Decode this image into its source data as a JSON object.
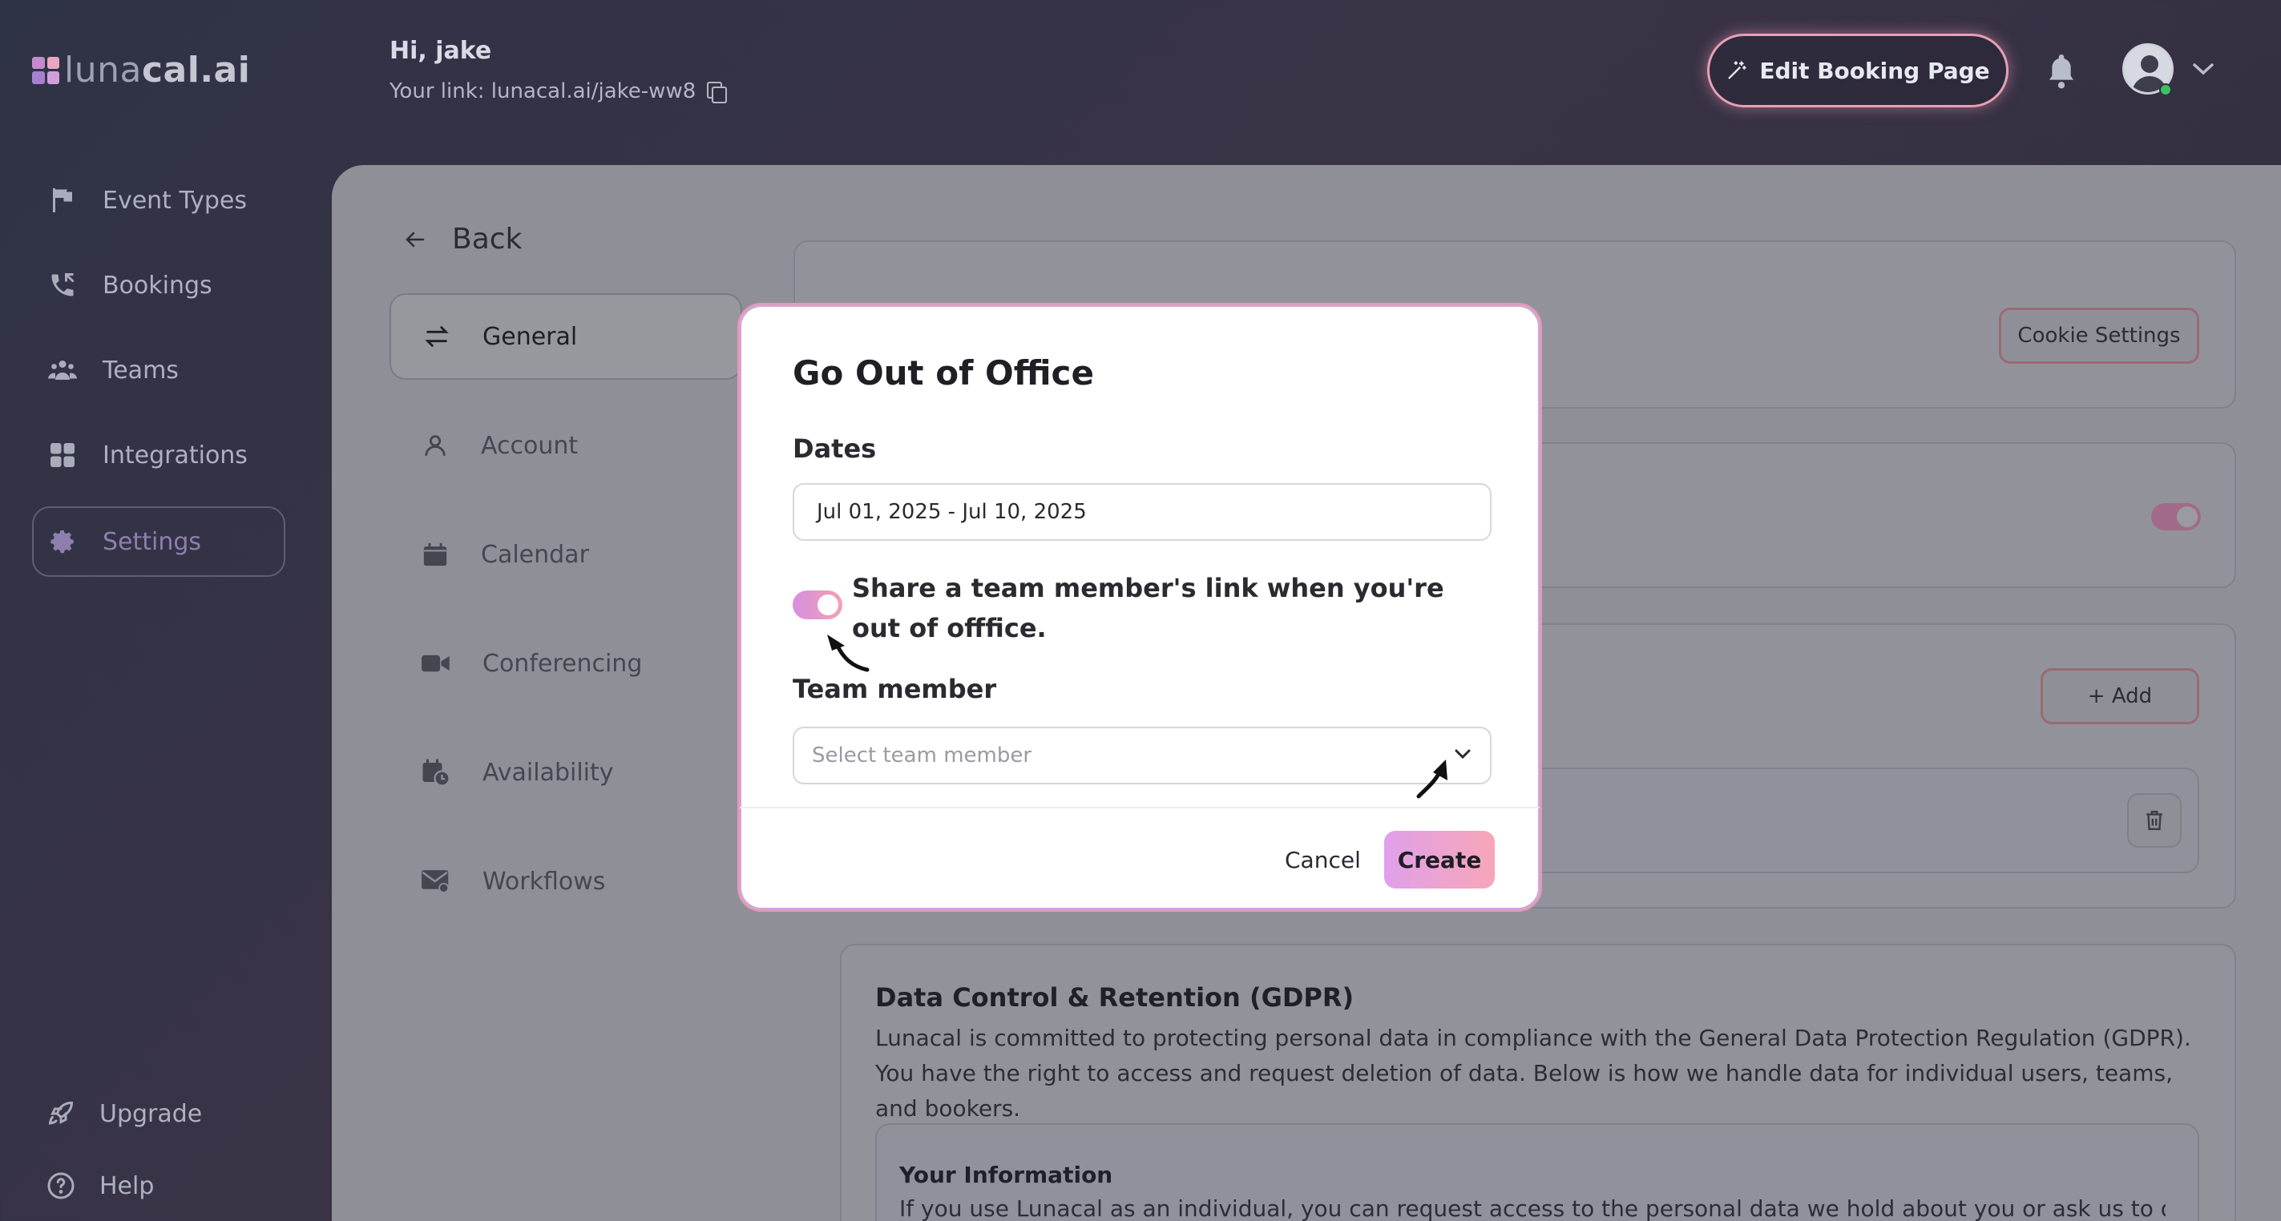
{
  "brand": {
    "logo_light": "luna",
    "logo_bold": "cal.ai"
  },
  "header": {
    "greeting": "Hi, jake",
    "link_text": "Your link: lunacal.ai/jake-ww8",
    "edit_booking_label": "Edit Booking Page"
  },
  "sidebar": {
    "items": [
      {
        "label": "Event Types",
        "icon": "flag-icon"
      },
      {
        "label": "Bookings",
        "icon": "phone-icon"
      },
      {
        "label": "Teams",
        "icon": "users-icon"
      },
      {
        "label": "Integrations",
        "icon": "grid-icon"
      },
      {
        "label": "Settings",
        "icon": "gear-icon",
        "active": true
      }
    ],
    "upgrade_label": "Upgrade",
    "help_label": "Help"
  },
  "settings": {
    "back_label": "Back",
    "subnav": [
      {
        "label": "General",
        "icon": "swap-icon",
        "active": true
      },
      {
        "label": "Account",
        "icon": "user-icon"
      },
      {
        "label": "Calendar",
        "icon": "calendar-icon"
      },
      {
        "label": "Conferencing",
        "icon": "video-icon"
      },
      {
        "label": "Availability",
        "icon": "calendar-clock-icon"
      },
      {
        "label": "Workflows",
        "icon": "mail-icon"
      }
    ],
    "cookie_settings_label": "Cookie Settings",
    "add_label": "+ Add",
    "gdpr": {
      "title": "Data Control & Retention (GDPR)",
      "text": "Lunacal is committed to protecting personal data in compliance with the General Data Protection Regulation (GDPR). You have the right to access and request deletion of data. Below is how we handle data for individual users, teams, and bookers.",
      "info_title": "Your Information",
      "info_text": "If you use Lunacal as an individual, you can request access to the personal data we hold about you or ask us to delete"
    }
  },
  "modal": {
    "title": "Go Out of Office",
    "dates_label": "Dates",
    "dates_value": "Jul 01, 2025 - Jul 10, 2025",
    "share_toggle_on": true,
    "share_text": "Share a team member's link when you're out of offfice.",
    "team_member_label": "Team member",
    "team_member_placeholder": "Select team member",
    "cancel_label": "Cancel",
    "create_label": "Create"
  },
  "colors": {
    "accent_gradient_start": "#e0a0ea",
    "accent_gradient_end": "#f7a6b8",
    "sidebar_bg": "#2f3346",
    "modal_border": "#e49ab6"
  }
}
